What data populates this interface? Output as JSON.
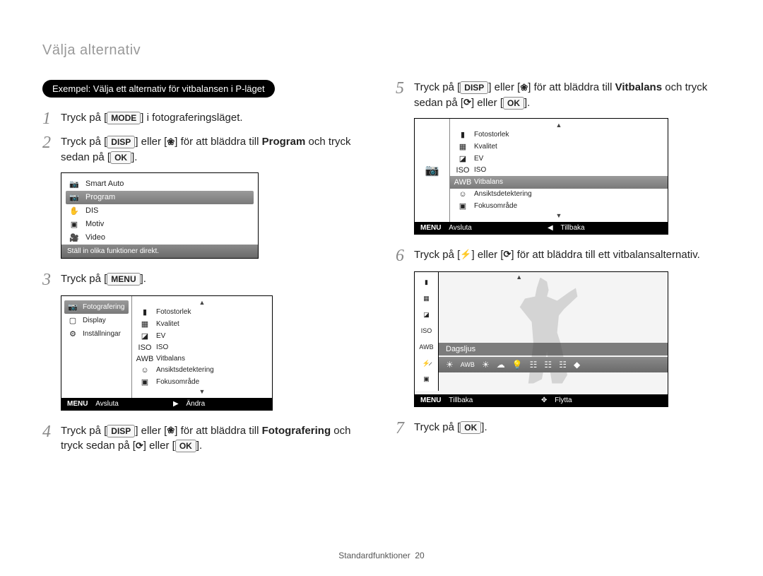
{
  "page": {
    "title": "Välja alternativ",
    "footer_label": "Standardfunktioner",
    "footer_page": "20"
  },
  "badge": "Exempel: Välja ett alternativ för vitbalansen i P-läget",
  "buttons": {
    "mode": "MODE",
    "disp": "DISP",
    "menu": "MENU",
    "ok": "OK",
    "menu_small": "MENU"
  },
  "text": {
    "s1a": "Tryck på [",
    "s1b": "] i fotograferingsläget.",
    "s2a": "Tryck på [",
    "s2b": "] eller [",
    "s2c": "] för att bläddra till ",
    "s2d": "Program",
    "s2e": " och tryck sedan på [",
    "s2f": "].",
    "s3a": "Tryck på [",
    "s3b": "].",
    "s4a": "Tryck på [",
    "s4b": "] eller [",
    "s4c": "] för att bläddra till ",
    "s4d": "Fotografering",
    "s4e": " och tryck sedan på [",
    "s4f": "] eller [",
    "s4g": "].",
    "s5a": "Tryck på [",
    "s5b": "] eller [",
    "s5c": "] för att bläddra till ",
    "s5d": "Vitbalans",
    "s5e": " och tryck sedan på [",
    "s5f": "] eller [",
    "s5g": "].",
    "s6a": "Tryck på [",
    "s6b": "] eller [",
    "s6c": "] för att bläddra till ett vitbalansalternativ.",
    "s7a": "Tryck på [",
    "s7b": "]."
  },
  "camera_ui": {
    "modes": {
      "items": [
        {
          "label": "Smart Auto",
          "selected": false
        },
        {
          "label": "Program",
          "selected": true
        },
        {
          "label": "DIS",
          "selected": false
        },
        {
          "label": "Motiv",
          "selected": false
        },
        {
          "label": "Video",
          "selected": false
        }
      ],
      "hint": "Ställ in olika funktioner direkt."
    },
    "menu": {
      "side": [
        {
          "label": "Fotografering",
          "selected": true
        },
        {
          "label": "Display",
          "selected": false
        },
        {
          "label": "Inställningar",
          "selected": false
        }
      ],
      "opts": [
        {
          "label": "Fotostorlek"
        },
        {
          "label": "Kvalitet"
        },
        {
          "label": "EV"
        },
        {
          "label": "ISO"
        },
        {
          "label": "Vitbalans"
        },
        {
          "label": "Ansiktsdetektering"
        },
        {
          "label": "Fokusområde"
        }
      ],
      "bottom": {
        "left": "Avsluta",
        "right": "Ändra"
      }
    },
    "shoot_opts": {
      "opts": [
        {
          "label": "Fotostorlek",
          "selected": false
        },
        {
          "label": "Kvalitet",
          "selected": false
        },
        {
          "label": "EV",
          "selected": false
        },
        {
          "label": "ISO",
          "selected": false
        },
        {
          "label": "Vitbalans",
          "selected": true
        },
        {
          "label": "Ansiktsdetektering",
          "selected": false
        },
        {
          "label": "Fokusområde",
          "selected": false
        }
      ],
      "bottom": {
        "left": "Avsluta",
        "right": "Tillbaka"
      }
    },
    "wb": {
      "label": "Dagsljus",
      "side_icons": [
        "size",
        "qual",
        "ev",
        "iso",
        "awb",
        "flash-off",
        "focus"
      ],
      "band_icons": [
        "sun",
        "awb",
        "sun2",
        "cloud",
        "bulb",
        "fluor1",
        "fluor2",
        "fluor3",
        "custom"
      ],
      "bottom": {
        "left": "Tillbaka",
        "right": "Flytta"
      }
    }
  }
}
